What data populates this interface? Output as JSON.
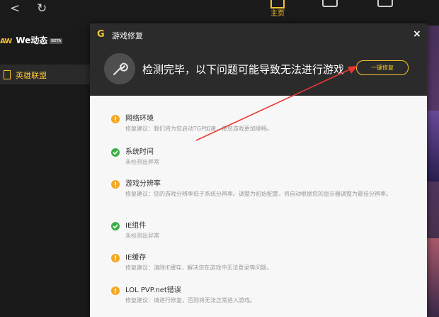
{
  "topbar": {
    "back_glyph": "<",
    "refresh_glyph": "↻",
    "home_label": "主页"
  },
  "sidebar": {
    "brand_mark": "AW",
    "brand_name": "We动态",
    "brand_badge": "BETA",
    "items": [
      {
        "label": "英雄联盟",
        "icon": "game-icon"
      }
    ]
  },
  "dialog": {
    "logo": "G",
    "title": "游戏修复",
    "close": "×",
    "headline": "检测完毕，以下问题可能导致无法进行游戏",
    "fix_button": "一键修复",
    "items": [
      {
        "status": "warn",
        "title": "网络环境",
        "desc": "修复建议：我们将为您启动TGP加速，使您游戏更加顺畅。"
      },
      {
        "status": "ok",
        "title": "系统时间",
        "desc": "未检测出异常"
      },
      {
        "status": "warn",
        "title": "游戏分辨率",
        "desc": "修复建议：您的游戏分辨率低于系统分辨率。调整为初始配置，将自动根据您的显示器调整为最佳分辨率。"
      },
      {
        "status": "ok",
        "title": "IE组件",
        "desc": "未检测出异常"
      },
      {
        "status": "warn",
        "title": "IE缓存",
        "desc": "修复建议：清除IE缓存，解决您在游戏中无法登录等问题。"
      },
      {
        "status": "warn",
        "title": "LOL PVP.net错误",
        "desc": "修复建议：请进行修复，否则将无法正常进入游戏。"
      }
    ]
  },
  "colors": {
    "accent": "#f4c430",
    "warn": "#f5a623",
    "ok": "#3fae49",
    "annotation_arrow": "#e53935"
  }
}
